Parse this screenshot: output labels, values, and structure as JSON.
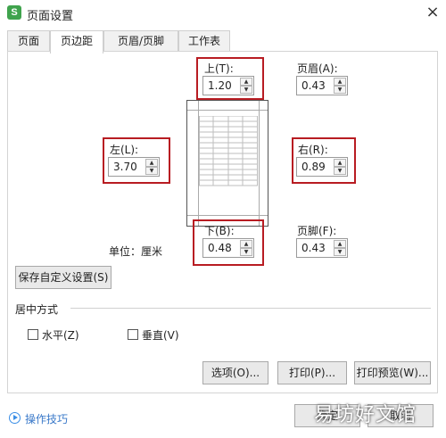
{
  "window": {
    "title": "页面设置",
    "app_icon_letter": "S",
    "close_glyph": "×"
  },
  "tabs": [
    {
      "label": "页面"
    },
    {
      "label": "页边距"
    },
    {
      "label": "页眉/页脚"
    },
    {
      "label": "工作表"
    }
  ],
  "margins": {
    "top": {
      "label": "上(T):",
      "value": "1.20"
    },
    "header": {
      "label": "页眉(A):",
      "value": "0.43"
    },
    "left": {
      "label": "左(L):",
      "value": "3.70"
    },
    "right": {
      "label": "右(R):",
      "value": "0.89"
    },
    "bottom": {
      "label": "下(B):",
      "value": "0.48"
    },
    "footer": {
      "label": "页脚(F):",
      "value": "0.43"
    }
  },
  "unit_text": "单位：厘米",
  "save_custom_label": "保存自定义设置(S)",
  "center": {
    "title": "居中方式",
    "horizontal_label": "水平(Z)",
    "vertical_label": "垂直(V)",
    "horizontal_checked": false,
    "vertical_checked": false
  },
  "buttons": {
    "options": "选项(O)...",
    "print": "打印(P)...",
    "print_preview": "打印预览(W)...",
    "ok": "确定",
    "cancel": "取消"
  },
  "footer": {
    "tips_link": "操作技巧"
  },
  "watermark": "易坊好文馆",
  "spin_arrows": {
    "up": "▲",
    "down": "▼"
  },
  "highlight_color": "#b81c22"
}
